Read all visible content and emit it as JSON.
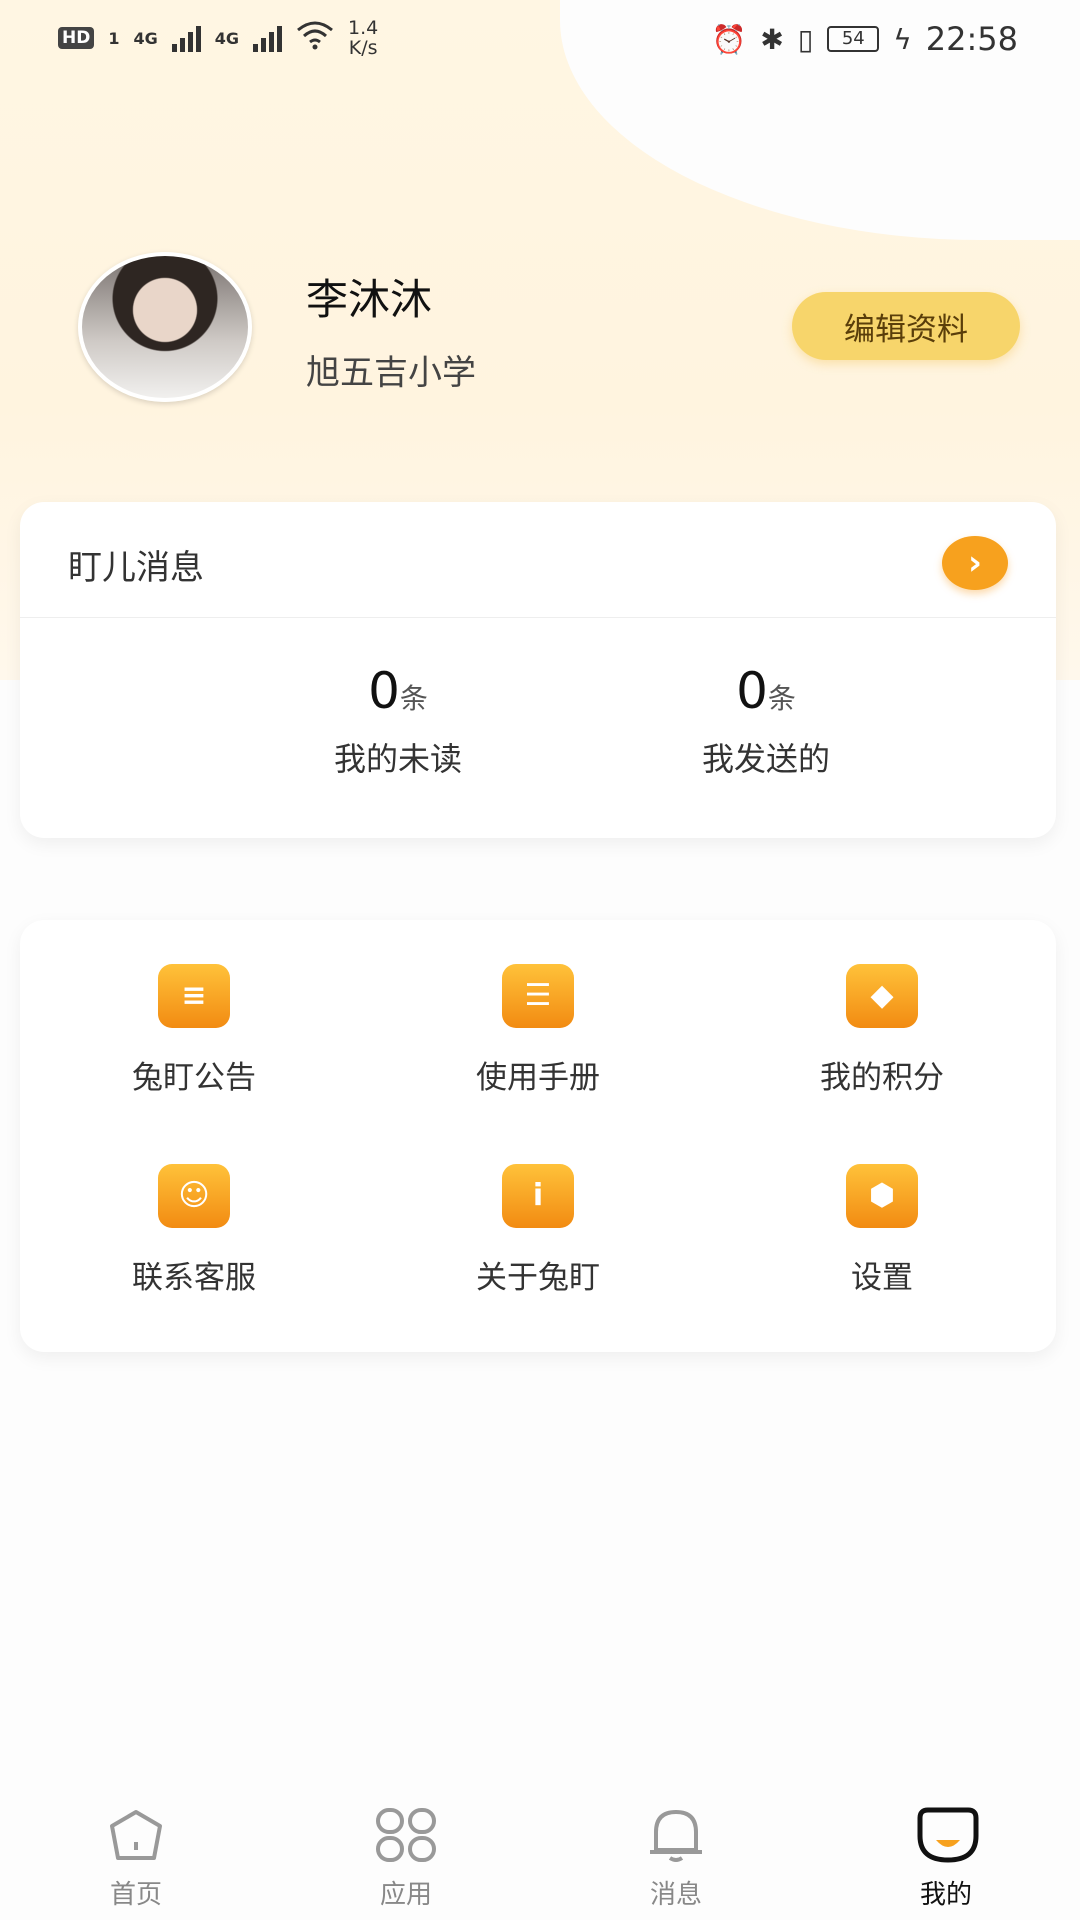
{
  "status_bar": {
    "hd": "HD",
    "sim": "1",
    "net1": "4G",
    "net2": "4G",
    "speed_value": "1.4",
    "speed_unit": "K/s",
    "battery": "54",
    "time": "22:58"
  },
  "profile": {
    "name": "李沐沐",
    "school": "旭五吉小学",
    "edit_label": "编辑资料"
  },
  "messages": {
    "title": "盯儿消息",
    "unread_count": "0",
    "unread_unit": "条",
    "unread_label": "我的未读",
    "sent_count": "0",
    "sent_unit": "条",
    "sent_label": "我发送的"
  },
  "functions": [
    {
      "label": "兔盯公告",
      "icon": "announcement-icon"
    },
    {
      "label": "使用手册",
      "icon": "manual-icon"
    },
    {
      "label": "我的积分",
      "icon": "points-icon"
    },
    {
      "label": "联系客服",
      "icon": "customer-service-icon"
    },
    {
      "label": "关于兔盯",
      "icon": "info-icon"
    },
    {
      "label": "设置",
      "icon": "settings-icon"
    }
  ],
  "tabs": [
    {
      "label": "首页",
      "icon": "home-icon"
    },
    {
      "label": "应用",
      "icon": "apps-icon"
    },
    {
      "label": "消息",
      "icon": "bell-icon"
    },
    {
      "label": "我的",
      "icon": "profile-icon",
      "active": true
    }
  ],
  "colors": {
    "accent": "#f7a11e",
    "edit_button": "#f7d56b",
    "header_bg": "#fff6e3"
  }
}
